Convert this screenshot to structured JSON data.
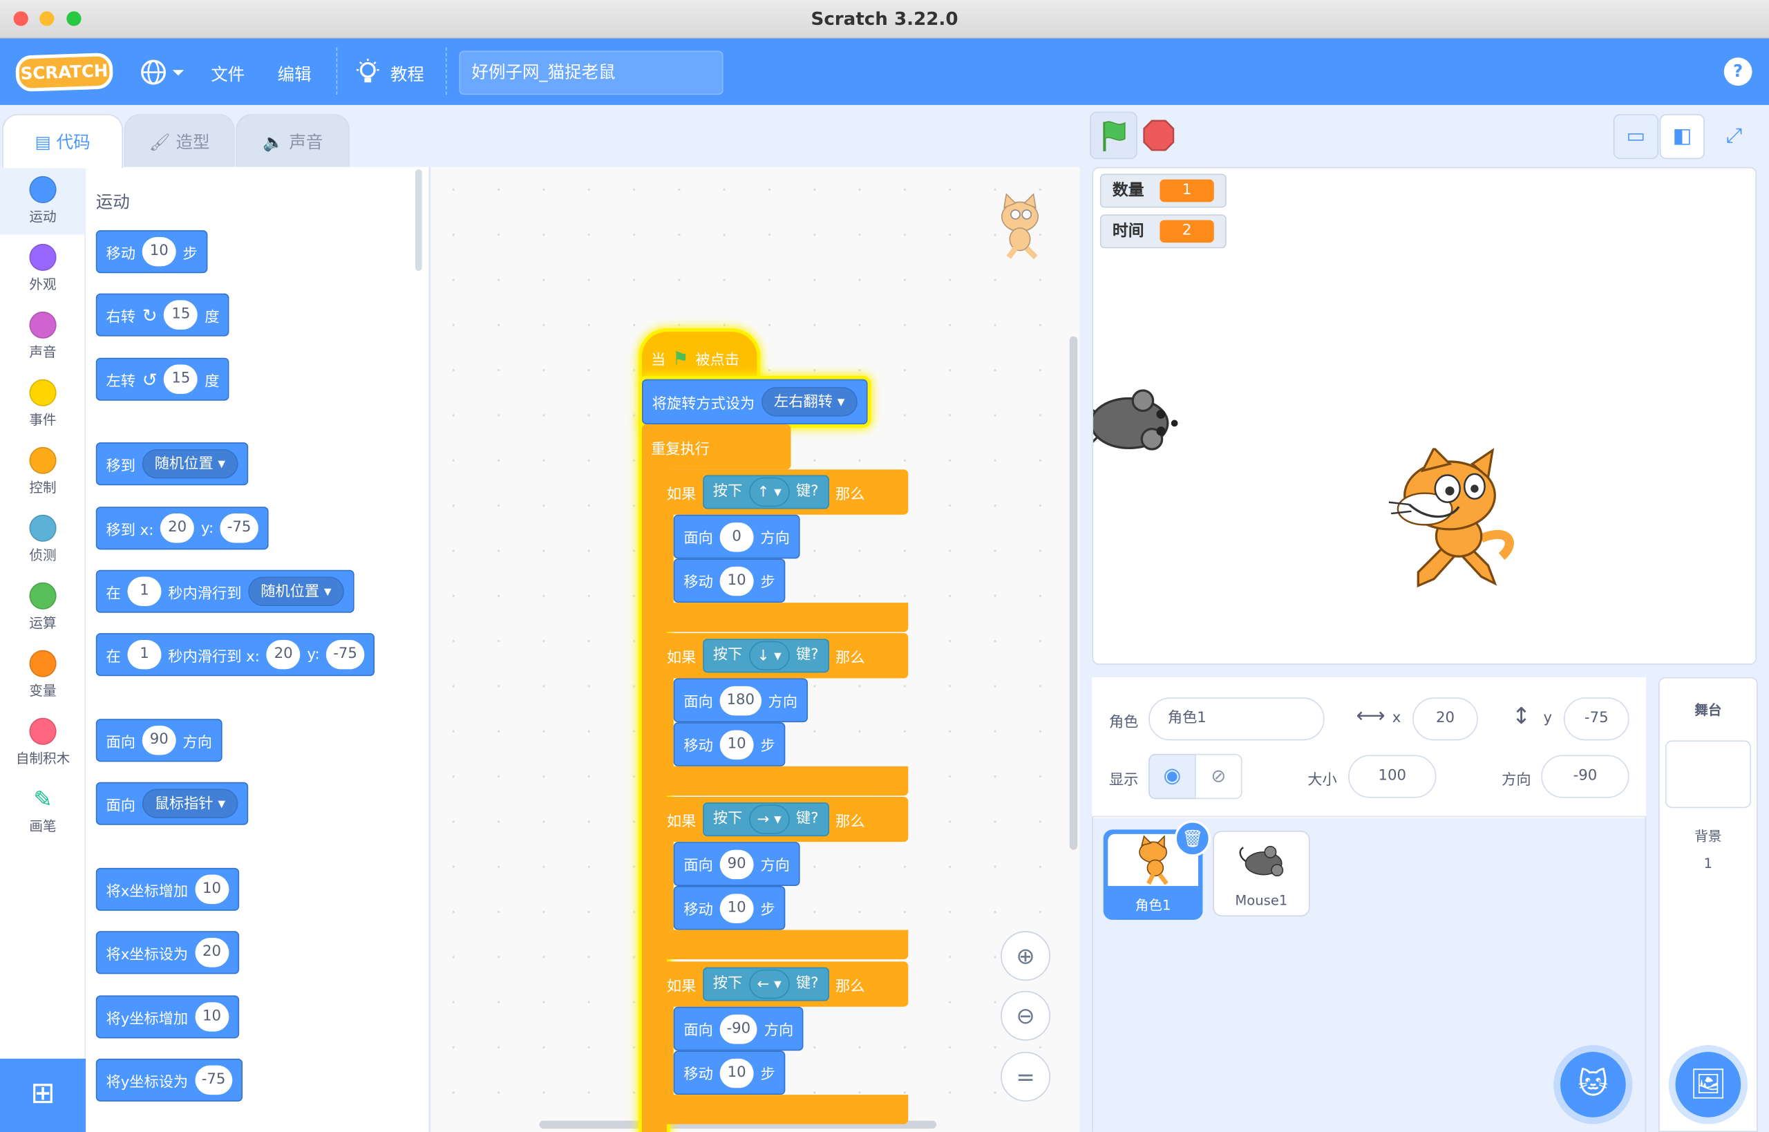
{
  "window": {
    "title": "Scratch 3.22.0"
  },
  "menu": {
    "logo": "SCRATCH",
    "file": "文件",
    "edit": "编辑",
    "tutorials": "教程",
    "project_title": "好例子网_猫捉老鼠",
    "help": "?"
  },
  "tabs": {
    "code": "代码",
    "costumes": "造型",
    "sounds": "声音"
  },
  "categories": [
    {
      "label": "运动",
      "color": "#4c97ff"
    },
    {
      "label": "外观",
      "color": "#9966ff"
    },
    {
      "label": "声音",
      "color": "#cf63cf"
    },
    {
      "label": "事件",
      "color": "#ffd500"
    },
    {
      "label": "控制",
      "color": "#ffab19"
    },
    {
      "label": "侦测",
      "color": "#5cb1d6"
    },
    {
      "label": "运算",
      "color": "#59c059"
    },
    {
      "label": "变量",
      "color": "#ff8c1a"
    },
    {
      "label": "自制积木",
      "color": "#ff6680"
    },
    {
      "label": "画笔",
      "color": "#0fbd8c"
    }
  ],
  "palette": {
    "heading": "运动",
    "move": {
      "a": "移动",
      "n": "10",
      "b": "步"
    },
    "turn_right": {
      "a": "右转",
      "n": "15",
      "b": "度"
    },
    "turn_left": {
      "a": "左转",
      "n": "15",
      "b": "度"
    },
    "goto": {
      "a": "移到",
      "dd": "随机位置"
    },
    "goto_xy": {
      "a": "移到 x:",
      "x": "20",
      "y_label": "y:",
      "y": "-75"
    },
    "glide": {
      "a": "在",
      "n": "1",
      "b": "秒内滑行到",
      "dd": "随机位置"
    },
    "glide_xy": {
      "a": "在",
      "n": "1",
      "b": "秒内滑行到 x:",
      "x": "20",
      "y_label": "y:",
      "y": "-75"
    },
    "point_dir": {
      "a": "面向",
      "n": "90",
      "b": "方向"
    },
    "point_towards": {
      "a": "面向",
      "dd": "鼠标指针"
    },
    "change_x": {
      "a": "将x坐标增加",
      "n": "10"
    },
    "set_x": {
      "a": "将x坐标设为",
      "n": "20"
    },
    "change_y": {
      "a": "将y坐标增加",
      "n": "10"
    },
    "set_y": {
      "a": "将y坐标设为",
      "n": "-75"
    }
  },
  "script": {
    "hat": {
      "a": "当",
      "b": "被点击"
    },
    "rotation": {
      "a": "将旋转方式设为",
      "dd": "左右翻转"
    },
    "forever": "重复执行",
    "if_label": "如果",
    "then_label": "那么",
    "key_pressed_a": "按下",
    "key_pressed_b": "键?",
    "face_label": "面向",
    "dir_label": "方向",
    "move_a": "移动",
    "move_b": "步",
    "ifs": [
      {
        "key": "↑",
        "dir": "0",
        "steps": "10"
      },
      {
        "key": "↓",
        "dir": "180",
        "steps": "10"
      },
      {
        "key": "→",
        "dir": "90",
        "steps": "10"
      },
      {
        "key": "←",
        "dir": "-90",
        "steps": "10"
      }
    ]
  },
  "stage": {
    "monitors": [
      {
        "label": "数量",
        "value": "1"
      },
      {
        "label": "时间",
        "value": "2"
      }
    ]
  },
  "sprite_info": {
    "sprite_label": "角色",
    "sprite_name": "角色1",
    "x_label": "x",
    "x": "20",
    "y_label": "y",
    "y": "-75",
    "show_label": "显示",
    "size_label": "大小",
    "size": "100",
    "direction_label": "方向",
    "direction": "-90"
  },
  "sprites": [
    {
      "name": "角色1",
      "selected": true
    },
    {
      "name": "Mouse1",
      "selected": false
    }
  ],
  "stage_panel": {
    "title": "舞台",
    "backdrop_label": "背景",
    "backdrop_count": "1"
  },
  "zoom": {
    "reset": "="
  }
}
